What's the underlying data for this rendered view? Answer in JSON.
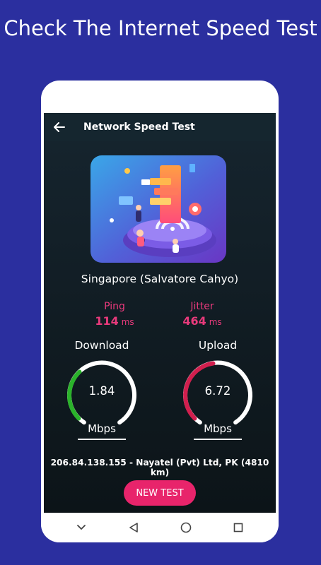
{
  "promo": {
    "headline": "Check The Internet Speed Test"
  },
  "appbar": {
    "title": "Network Speed Test",
    "back_icon": "arrow-left-icon"
  },
  "server": {
    "name": "Singapore (Salvatore Cahyo)"
  },
  "ping": {
    "label": "Ping",
    "value": "114",
    "unit": "ms"
  },
  "jitter": {
    "label": "Jitter",
    "value": "464",
    "unit": "ms"
  },
  "download": {
    "label": "Download",
    "value": "1.84",
    "unit": "Mbps",
    "arc_fraction": 0.34
  },
  "upload": {
    "label": "Upload",
    "value": "6.72",
    "unit": "Mbps",
    "arc_fraction": 0.47
  },
  "connection": {
    "info": "206.84.138.155 - Nayatel (Pvt) Ltd, PK (4810 km)"
  },
  "actions": {
    "new_test_label": "NEW TEST"
  },
  "navbar": {
    "icons": [
      "chevron-down-icon",
      "back-triangle-icon",
      "home-circle-icon",
      "recents-square-icon"
    ]
  },
  "colors": {
    "background": "#2b2f9f",
    "accent_pink": "#e93a7c",
    "button": "#e8246b",
    "download_arc": "#2bb32b",
    "upload_arc": "#d11f4e",
    "screen": "#101b21"
  }
}
